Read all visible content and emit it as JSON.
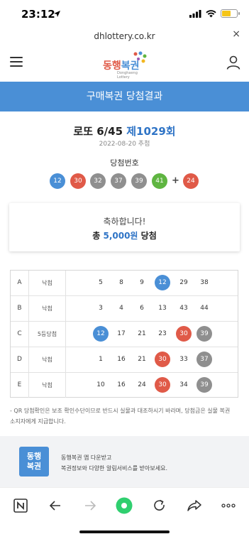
{
  "status_bar": {
    "time": "23:12"
  },
  "browser": {
    "url": "dhlottery.co.kr",
    "close_label": "×"
  },
  "header": {
    "logo_text": "동행복권",
    "logo_sub": "Donghaeng Lottery"
  },
  "banner": {
    "title": "구매복권 당첨결과"
  },
  "draw": {
    "game": "로또 6/45",
    "round": "제1029회",
    "date": "2022-08-20 추첨",
    "winning_label": "당첨번호",
    "numbers": [
      "12",
      "30",
      "32",
      "37",
      "39",
      "41"
    ],
    "plus": "+",
    "bonus": "24"
  },
  "prize": {
    "congrats": "축하합니다!",
    "prefix": "총",
    "amount": "5,000원",
    "suffix": "당첨"
  },
  "ticket": [
    {
      "game": "A",
      "result": "낙첨",
      "numbers": [
        "5",
        "8",
        "9",
        "12",
        "29",
        "38"
      ]
    },
    {
      "game": "B",
      "result": "낙첨",
      "numbers": [
        "3",
        "4",
        "6",
        "13",
        "43",
        "44"
      ]
    },
    {
      "game": "C",
      "result": "5등당첨",
      "numbers": [
        "12",
        "17",
        "21",
        "23",
        "30",
        "39"
      ]
    },
    {
      "game": "D",
      "result": "낙첨",
      "numbers": [
        "1",
        "16",
        "21",
        "30",
        "33",
        "37"
      ]
    },
    {
      "game": "E",
      "result": "낙첨",
      "numbers": [
        "10",
        "16",
        "24",
        "30",
        "34",
        "39"
      ]
    }
  ],
  "notice": {
    "line1": "- QR 당첨확인은 보조 확인수단이므로 반드시 실물과 대조하시기 바라며, 당첨금은 실물 복권",
    "line2": "소지자에게 지급합니다."
  },
  "promo": {
    "logo_line1": "동행",
    "logo_line2": "복권",
    "line1": "동행복권 앱 다운받고",
    "line2": "복권정보와 다양한 알림서비스를 받아보세요."
  },
  "ball_colors": {
    "range_1_10": "#f2b720",
    "range_11_20": "#4a8fd6",
    "range_21_30": "#e05a48",
    "range_31_40": "#8f8f8f",
    "range_41_45": "#5fb541"
  },
  "colors": {
    "accent": "#4a8fd6",
    "highlight_text": "#2f74c6"
  },
  "icons": [
    "navigation-arrow-icon",
    "signal-icon",
    "wifi-icon",
    "battery-icon",
    "menu-icon",
    "user-icon",
    "n-app-icon",
    "back-icon",
    "forward-icon",
    "home-icon",
    "reload-icon",
    "share-icon",
    "more-icon"
  ]
}
